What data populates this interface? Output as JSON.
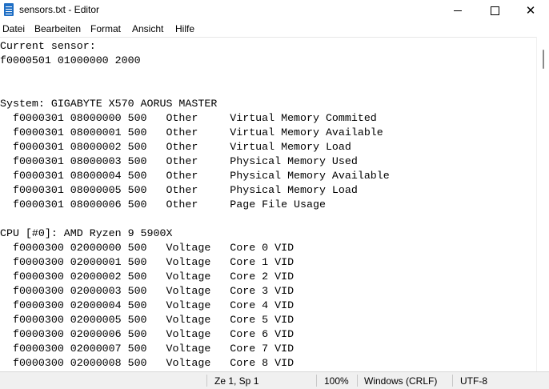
{
  "window": {
    "title": "sensors.txt - Editor",
    "minimize_icon": "minimize-icon",
    "maximize_icon": "maximize-icon",
    "close_icon": "close-icon",
    "close_glyph": "✕"
  },
  "menu": [
    "Datei",
    "Bearbeiten",
    "Format",
    "Ansicht",
    "Hilfe"
  ],
  "editor_lines": [
    "Current sensor:",
    "f0000501 01000000 2000",
    "",
    "",
    "System: GIGABYTE X570 AORUS MASTER",
    "  f0000301 08000000 500   Other     Virtual Memory Commited",
    "  f0000301 08000001 500   Other     Virtual Memory Available",
    "  f0000301 08000002 500   Other     Virtual Memory Load",
    "  f0000301 08000003 500   Other     Physical Memory Used",
    "  f0000301 08000004 500   Other     Physical Memory Available",
    "  f0000301 08000005 500   Other     Physical Memory Load",
    "  f0000301 08000006 500   Other     Page File Usage",
    "",
    "CPU [#0]: AMD Ryzen 9 5900X",
    "  f0000300 02000000 500   Voltage   Core 0 VID",
    "  f0000300 02000001 500   Voltage   Core 1 VID",
    "  f0000300 02000002 500   Voltage   Core 2 VID",
    "  f0000300 02000003 500   Voltage   Core 3 VID",
    "  f0000300 02000004 500   Voltage   Core 4 VID",
    "  f0000300 02000005 500   Voltage   Core 5 VID",
    "  f0000300 02000006 500   Voltage   Core 6 VID",
    "  f0000300 02000007 500   Voltage   Core 7 VID",
    "  f0000300 02000008 500   Voltage   Core 8 VID"
  ],
  "status": {
    "position": "Ze 1, Sp 1",
    "zoom": "100%",
    "line_ending": "Windows (CRLF)",
    "encoding": "UTF-8"
  }
}
